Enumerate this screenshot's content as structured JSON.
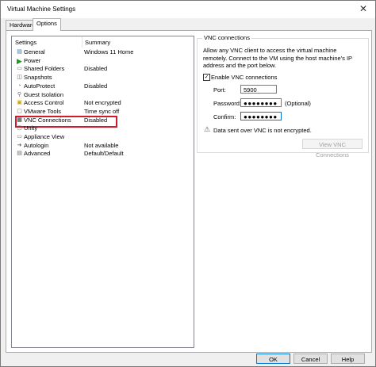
{
  "window": {
    "title": "Virtual Machine Settings",
    "close_glyph": "✕"
  },
  "tabs": [
    {
      "label": "Hardware",
      "active": false
    },
    {
      "label": "Options",
      "active": true
    }
  ],
  "settings_list": {
    "headers": {
      "settings": "Settings",
      "summary": "Summary"
    },
    "rows": [
      {
        "name": "General",
        "summary": "Windows 11 Home",
        "icon": "general-icon"
      },
      {
        "name": "Power",
        "summary": "",
        "icon": "power-icon"
      },
      {
        "name": "Shared Folders",
        "summary": "Disabled",
        "icon": "shared-folders-icon"
      },
      {
        "name": "Snapshots",
        "summary": "",
        "icon": "snapshots-icon"
      },
      {
        "name": "AutoProtect",
        "summary": "Disabled",
        "icon": "autoprotect-icon"
      },
      {
        "name": "Guest Isolation",
        "summary": "",
        "icon": "guest-isolation-icon"
      },
      {
        "name": "Access Control",
        "summary": "Not encrypted",
        "icon": "access-control-icon"
      },
      {
        "name": "VMware Tools",
        "summary": "Time sync off",
        "icon": "vmware-tools-icon"
      },
      {
        "name": "VNC Connections",
        "summary": "Disabled",
        "icon": "vnc-connections-icon",
        "selected": true
      },
      {
        "name": "Unity",
        "summary": "",
        "icon": "unity-icon"
      },
      {
        "name": "Appliance View",
        "summary": "",
        "icon": "appliance-view-icon"
      },
      {
        "name": "Autologin",
        "summary": "Not available",
        "icon": "autologin-icon"
      },
      {
        "name": "Advanced",
        "summary": "Default/Default",
        "icon": "advanced-icon"
      }
    ]
  },
  "vnc": {
    "group_title": "VNC connections",
    "description": "Allow any VNC client to access the virtual machine remotely. Connect to the VM using the host machine's IP address and the port below.",
    "enable_label": "Enable VNC connections",
    "enable_checked": true,
    "port_label": "Port:",
    "port_value": "5900",
    "password_label": "Password:",
    "password_value": "●●●●●●●●",
    "optional_label": "(Optional)",
    "confirm_label": "Confirm:",
    "confirm_value": "●●●●●●●●",
    "warning_text": "Data sent over VNC is not encrypted.",
    "view_button": "View VNC Connections"
  },
  "footer": {
    "ok": "OK",
    "cancel": "Cancel",
    "help": "Help"
  }
}
